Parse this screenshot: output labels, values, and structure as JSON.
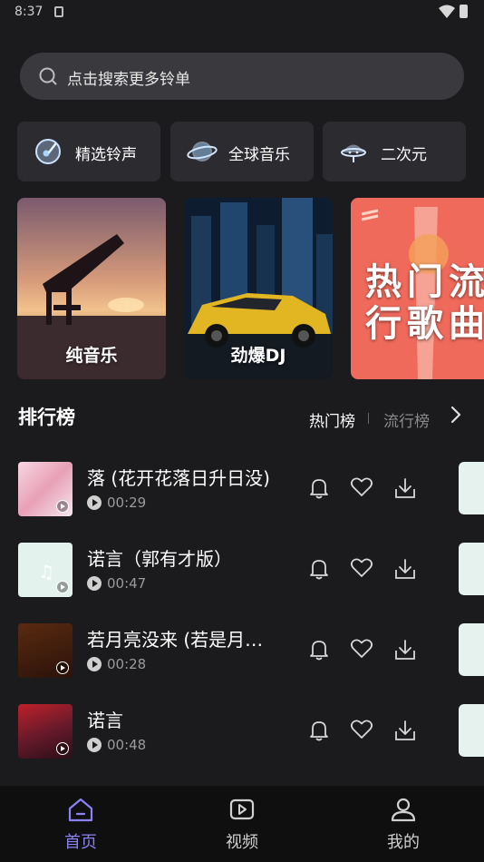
{
  "status": {
    "time": "8:37"
  },
  "search": {
    "placeholder": "点击搜索更多铃单"
  },
  "categories": [
    {
      "label": "精选铃声",
      "icon": "music-disc-icon"
    },
    {
      "label": "全球音乐",
      "icon": "planet-icon"
    },
    {
      "label": "二次元",
      "icon": "ufo-icon"
    }
  ],
  "banners": [
    {
      "label": "纯音乐"
    },
    {
      "label": "劲爆DJ"
    },
    {
      "label": "热门流行歌曲"
    }
  ],
  "ranking": {
    "title": "排行榜",
    "tab_hot": "热门榜",
    "tab_pop": "流行榜"
  },
  "songs": [
    {
      "title": "落 (花开花落日升日没)",
      "duration": "00:29"
    },
    {
      "title": "诺言（郭有才版）",
      "duration": "00:47"
    },
    {
      "title": "若月亮没来 (若是月…",
      "duration": "00:28"
    },
    {
      "title": "诺言",
      "duration": "00:48"
    }
  ],
  "tabs": [
    {
      "label": "首页",
      "active": true
    },
    {
      "label": "视频",
      "active": false
    },
    {
      "label": "我的",
      "active": false
    }
  ],
  "colors": {
    "accent": "#8a82f6",
    "background": "#1b1b1e",
    "card": "#2c2c30"
  }
}
